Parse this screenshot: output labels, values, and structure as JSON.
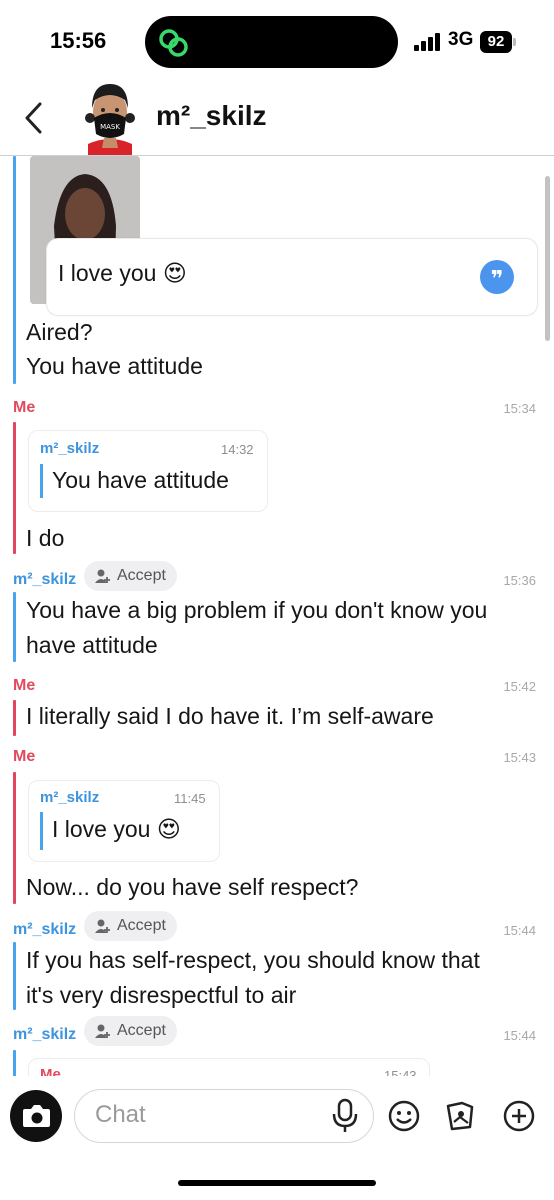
{
  "status_bar": {
    "time": "15:56",
    "network": "3G",
    "battery": "92"
  },
  "header": {
    "title": "m²_skilz"
  },
  "messages": {
    "top": {
      "reply_text": "I love you 😍",
      "line1": "Aired?",
      "line2": "You have attitude"
    },
    "m1": {
      "sender": "Me",
      "time": "15:34",
      "quote_name": "m²_skilz",
      "quote_time": "14:32",
      "quote_text": "You have attitude",
      "text": "I do"
    },
    "m2": {
      "sender": "m²_skilz",
      "accept": "Accept",
      "time": "15:36",
      "line1": "You have a big problem if you don't know you",
      "line2": "have attitude"
    },
    "m3": {
      "sender": "Me",
      "time": "15:42",
      "text": "I literally said I do have it. I’m self-aware"
    },
    "m4": {
      "sender": "Me",
      "time": "15:43",
      "quote_name": "m²_skilz",
      "quote_time": "11:45",
      "quote_text": "I love you 😍",
      "text": "Now... do you have self respect?"
    },
    "m5": {
      "sender": "m²_skilz",
      "accept": "Accept",
      "time": "15:44",
      "line1": "If you has self-respect, you should know that",
      "line2": "it's very disrespectful to air"
    },
    "m6": {
      "sender": "m²_skilz",
      "accept": "Accept",
      "time": "15:44",
      "quote_name": "Me",
      "quote_time": "15:43"
    }
  },
  "input": {
    "placeholder": "Chat"
  },
  "icons": [
    "camera-icon",
    "mic-icon",
    "emoji-icon",
    "sticker-icon",
    "plus-icon",
    "back-chevron-icon",
    "quote-icon",
    "add-friend-icon"
  ],
  "colors": {
    "me": "#e14a5f",
    "friend": "#3d94de",
    "quote_button": "#4b95ef"
  }
}
